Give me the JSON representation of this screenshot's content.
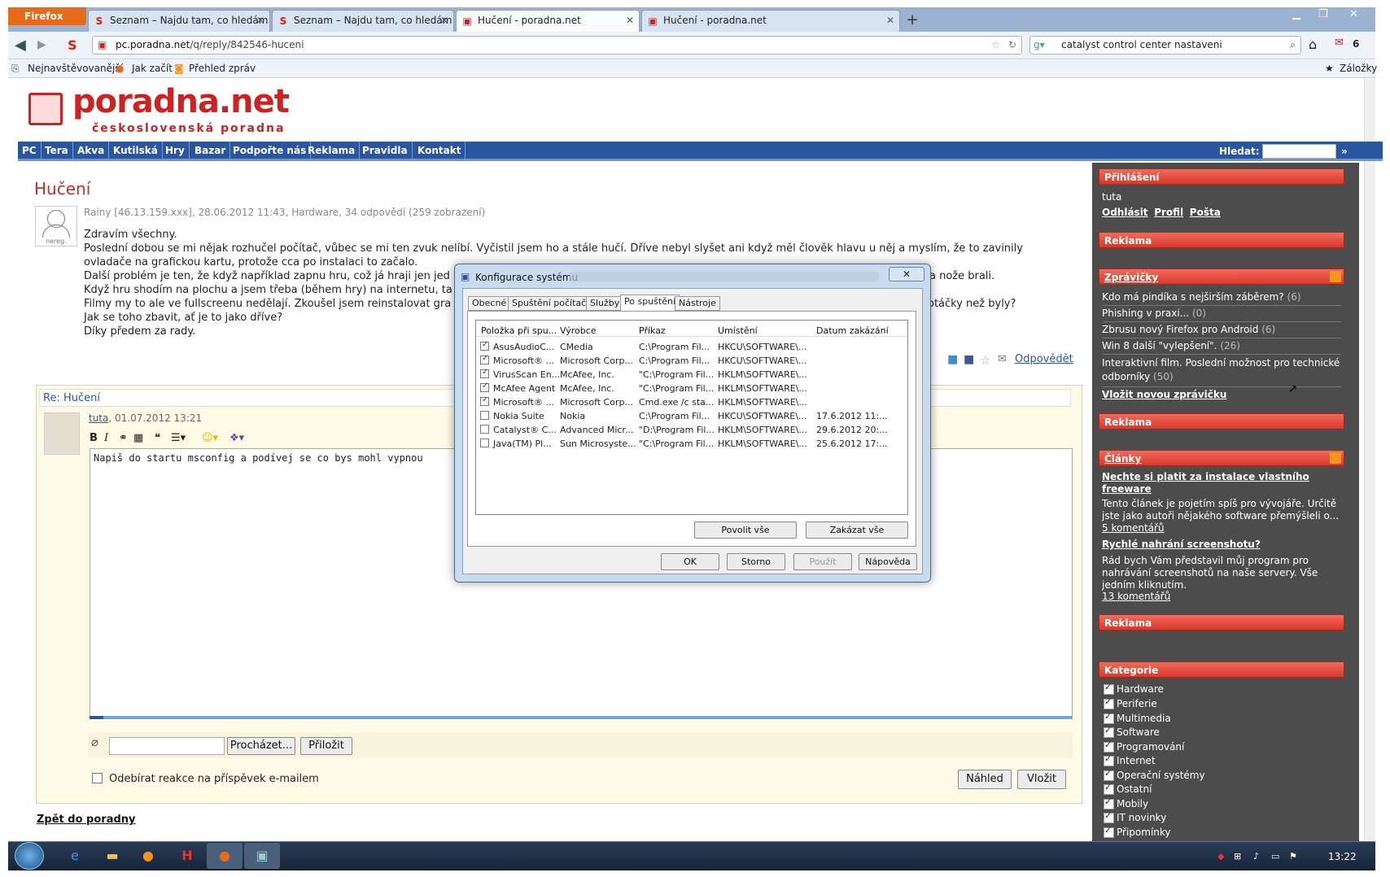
{
  "browser": {
    "firefox_button": "Firefox",
    "tabs": [
      {
        "label": "Seznam – Najdu tam, co hledám",
        "active": false
      },
      {
        "label": "Seznam – Najdu tam, co hledám",
        "active": false
      },
      {
        "label": "Hučení - poradna.net",
        "active": true
      },
      {
        "label": "Hučení - poradna.net",
        "active": false
      }
    ],
    "url_host": "pc.poradna.net",
    "url_path": "/q/reply/842546-huceni",
    "search_text": "catalyst control center nastaveni",
    "badge_count": "6",
    "bookmarks": [
      "Nejnavštěvovanější",
      "Jak začít",
      "Přehled zpráv"
    ],
    "bookmarks_right": "Záložky"
  },
  "site": {
    "logo_name": "poradna.net",
    "logo_sub": "československá poradna",
    "menu": [
      "PC",
      "Tera",
      "Akva",
      "Kutilská",
      "Hry",
      "Bazar",
      "Podpořte nás",
      "Reklama",
      "Pravidla",
      "Kontakt"
    ],
    "search_label": "Hledat:",
    "search_go": "»"
  },
  "question": {
    "title": "Hučení",
    "meta": "Rainy [46.13.159.xxx], 28.06.2012 11:43, Hardware, 34 odpovědí (259 zobrazení)",
    "avatar_label": "nereg.",
    "lines": [
      "Zdravím všechny.",
      "Poslední dobou se mi nějak rozhučel počítač, vůbec se mi ten zvuk nelíbí. Vyčistil jsem ho a stále hučí. Dříve nebyl slyšet ani když měl člověk hlavu u něj a myslím, že to zavinily",
      "ovladače na grafickou kartu, protože cca po instalaci to začalo.",
      "Další problém je ten, že když například zapnu hru, což já hraji jen jed",
      "Když hru shodím na plochu a jsem třeba (během hry) na internetu, ta",
      "Filmy my to ale ve fullscreenu nedělají. Zkoušel jsem reinstalovat gra",
      "Jak se toho zbavit, ať je to jako dříve?",
      "Díky předem za rady."
    ],
    "line_tail_1": "a nože brali.",
    "line_tail_2": "otáčky než byly?",
    "answer_link": "Odpovědět"
  },
  "reply": {
    "title": "Re: Hučení",
    "user": "tuta",
    "date": ", 01.07.2012 13:21",
    "editor_text": "Napiš do startu msconfig a podívej se co bys mohl vypnou",
    "browse_button": "Procházet...",
    "attach_button": "Přiložit",
    "subscribe_label": "Odebírat reakce na příspěvek e-mailem",
    "preview_button": "Náhled",
    "submit_button": "Vložit",
    "back_link": "Zpět do poradny"
  },
  "sidebar": {
    "login_title": "Přihlášení",
    "login_user": "tuta",
    "login_links": [
      "Odhlásit",
      "Profil",
      "Pošta"
    ],
    "ad_title": "Reklama",
    "news_title": "Zprávičky",
    "news": [
      {
        "text": "Kdo má pindíka s nejširším záběrem?",
        "count": "(6)"
      },
      {
        "text": "Phishing v praxi...",
        "count": "(0)"
      },
      {
        "text": "Zbrusu nový Firefox pro Android",
        "count": "(6)"
      },
      {
        "text": "Win 8 další \"vylepšení\".",
        "count": "(26)"
      },
      {
        "text": "Interaktivní film. Poslední možnost pro technické odborníky",
        "count": "(50)"
      }
    ],
    "news_add": "Vložit novou zprávičku",
    "articles_title": "Články",
    "articles": [
      {
        "title": "Nechte si platit za instalace vlastního freeware",
        "text": "Tento článek je pojetím spíš pro vývojáře. Určitě jste jako autoři nějakého software přemýšleli o...",
        "comments": "5 komentářů"
      },
      {
        "title": "Rychlé nahrání screenshotu?",
        "text": "Rád bych Vám představil můj program pro nahrávání screenshotů na naše servery. Vše jedním kliknutím.",
        "comments": "13 komentářů"
      }
    ],
    "categories_title": "Kategorie",
    "categories": [
      "Hardware",
      "Periferie",
      "Multimedia",
      "Software",
      "Programování",
      "Internet",
      "Operační systémy",
      "Ostatní",
      "Mobily",
      "IT novinky",
      "Připomínky"
    ]
  },
  "dialog": {
    "title": "Konfigurace systému",
    "close": "✕",
    "tabs": [
      "Obecné",
      "Spuštění počítače",
      "Služby",
      "Po spuštění",
      "Nástroje"
    ],
    "active_tab": "Po spuštění",
    "columns": [
      "Položka při spu...",
      "Výrobce",
      "Příkaz",
      "Umístění",
      "Datum zakázání"
    ],
    "rows": [
      {
        "checked": true,
        "item": "AsusAudioC...",
        "vendor": "CMedia",
        "cmd": "C:\\Program Fil...",
        "loc": "HKCU\\SOFTWARE\\...",
        "date": ""
      },
      {
        "checked": true,
        "item": "Microsoft® ...",
        "vendor": "Microsoft Corp...",
        "cmd": "C:\\Program Fil...",
        "loc": "HKCU\\SOFTWARE\\...",
        "date": ""
      },
      {
        "checked": true,
        "item": "VirusScan En...",
        "vendor": "McAfee, Inc.",
        "cmd": "\"C:\\Program Fil...",
        "loc": "HKLM\\SOFTWARE\\...",
        "date": ""
      },
      {
        "checked": true,
        "item": "McAfee Agent",
        "vendor": "McAfee, Inc.",
        "cmd": "\"C:\\Program Fil...",
        "loc": "HKLM\\SOFTWARE\\...",
        "date": ""
      },
      {
        "checked": true,
        "item": "Microsoft® ...",
        "vendor": "Microsoft Corp...",
        "cmd": "Cmd.exe /c sta...",
        "loc": "HKLM\\SOFTWARE\\...",
        "date": ""
      },
      {
        "checked": false,
        "item": "Nokia Suite",
        "vendor": "Nokia",
        "cmd": "C:\\Program Fil...",
        "loc": "HKCU\\SOFTWARE\\...",
        "date": "17.6.2012 11:..."
      },
      {
        "checked": false,
        "item": "Catalyst® C...",
        "vendor": "Advanced Micr...",
        "cmd": "\"D:\\Program Fil...",
        "loc": "HKLM\\SOFTWARE\\...",
        "date": "29.6.2012 20:..."
      },
      {
        "checked": false,
        "item": "Java(TM) Pl...",
        "vendor": "Sun Microsyste...",
        "cmd": "\"C:\\Program Fil...",
        "loc": "HKLM\\SOFTWARE\\...",
        "date": "25.6.2012 17:..."
      }
    ],
    "enable_all": "Povolit vše",
    "disable_all": "Zakázat vše",
    "ok": "OK",
    "cancel": "Storno",
    "apply": "Použít",
    "help": "Nápověda"
  },
  "taskbar": {
    "clock": "13:22"
  }
}
